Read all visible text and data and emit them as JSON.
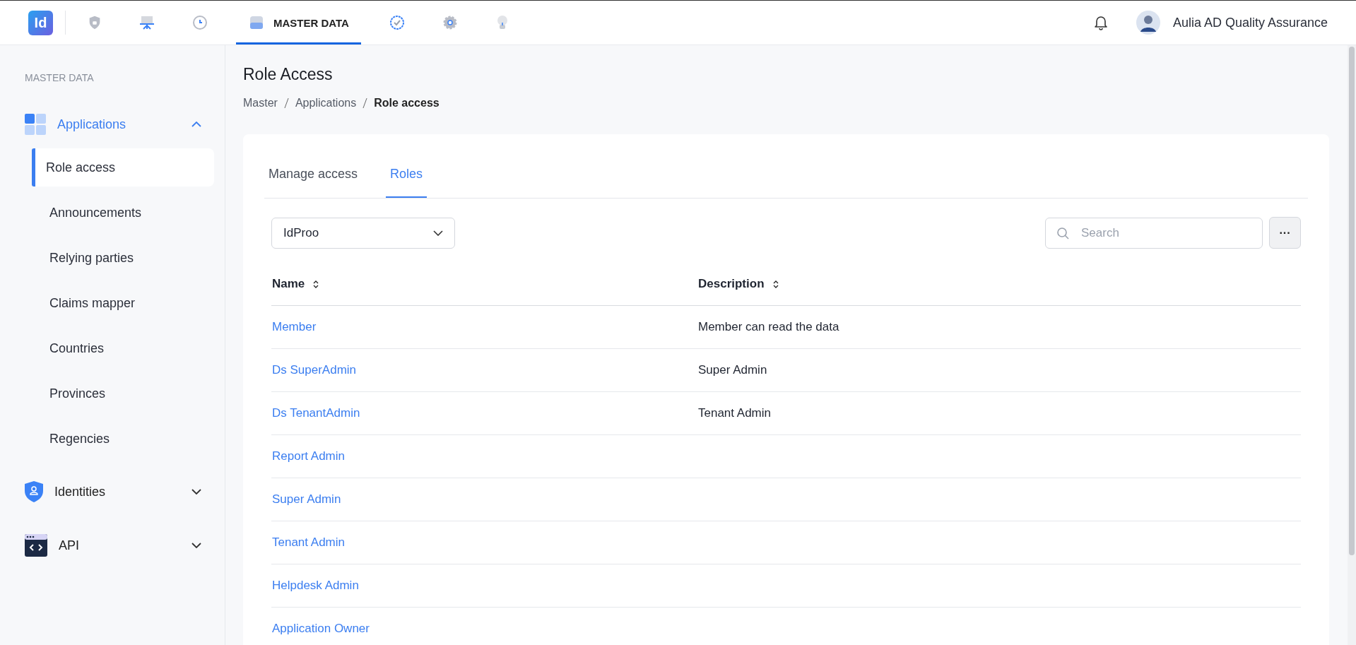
{
  "topbar": {
    "logo": "Id",
    "nav": [
      {
        "kind": "shield",
        "selected": false
      },
      {
        "kind": "board",
        "selected": false
      },
      {
        "kind": "history",
        "selected": false
      },
      {
        "kind": "drive",
        "label": "MASTER DATA",
        "selected": true
      },
      {
        "kind": "badge",
        "selected": false
      },
      {
        "kind": "gear",
        "selected": false
      },
      {
        "kind": "bulb",
        "selected": false
      }
    ],
    "user": "Aulia AD Quality Assurance"
  },
  "sidebar": {
    "heading": "MASTER DATA",
    "groups": [
      {
        "label": "Applications",
        "kind": "grid",
        "expanded": true,
        "children": [
          {
            "label": "Role access",
            "selected": true
          },
          {
            "label": "Announcements",
            "selected": false
          },
          {
            "label": "Relying parties",
            "selected": false
          },
          {
            "label": "Claims mapper",
            "selected": false
          },
          {
            "label": "Countries",
            "selected": false
          },
          {
            "label": "Provinces",
            "selected": false
          },
          {
            "label": "Regencies",
            "selected": false
          }
        ]
      },
      {
        "label": "Identities",
        "kind": "shield",
        "expanded": false
      },
      {
        "label": "API",
        "kind": "code",
        "expanded": false
      }
    ]
  },
  "page": {
    "title": "Role Access",
    "breadcrumb": [
      "Master",
      "Applications",
      "Role access"
    ]
  },
  "tabs": [
    {
      "label": "Manage access",
      "selected": false
    },
    {
      "label": "Roles",
      "selected": true
    }
  ],
  "filter": {
    "value": "IdProo"
  },
  "search": {
    "placeholder": "Search"
  },
  "more_button": "···",
  "table": {
    "columns": [
      "Name",
      "Description"
    ],
    "rows": [
      {
        "name": "Member",
        "description": "Member can read the data"
      },
      {
        "name": "Ds SuperAdmin",
        "description": "Super Admin"
      },
      {
        "name": "Ds TenantAdmin",
        "description": "Tenant Admin"
      },
      {
        "name": "Report Admin"
      },
      {
        "name": "Super Admin"
      },
      {
        "name": "Tenant Admin"
      },
      {
        "name": "Helpdesk Admin"
      },
      {
        "name": "Application Owner"
      }
    ]
  }
}
